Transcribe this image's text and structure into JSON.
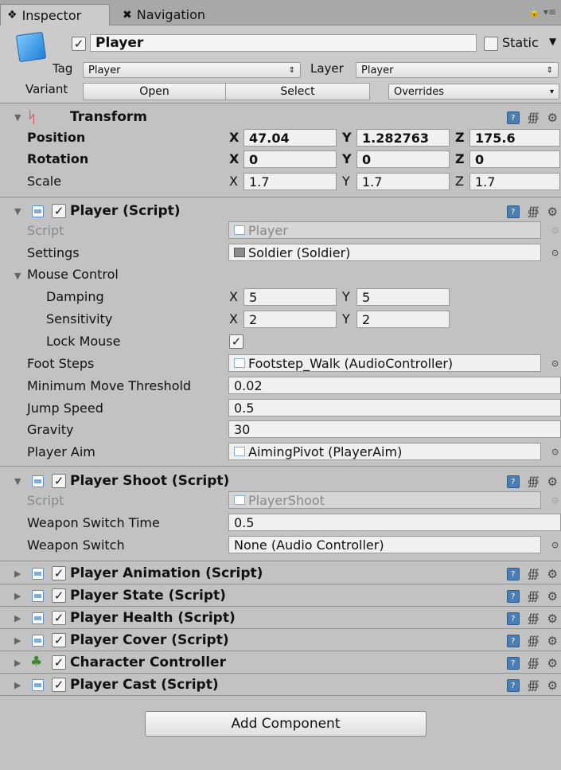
{
  "tabs": {
    "inspector": "Inspector",
    "navigation": "Navigation"
  },
  "gameobject": {
    "name": "Player",
    "active": true,
    "static_label": "Static",
    "tag_label": "Tag",
    "tag_value": "Player",
    "layer_label": "Layer",
    "layer_value": "Player",
    "variant_label": "Variant",
    "open_label": "Open",
    "select_label": "Select",
    "overrides_label": "Overrides"
  },
  "transform": {
    "title": "Transform",
    "position": {
      "label": "Position",
      "x": "47.04",
      "y": "1.282763",
      "z": "175.6"
    },
    "rotation": {
      "label": "Rotation",
      "x": "0",
      "y": "0",
      "z": "0"
    },
    "scale": {
      "label": "Scale",
      "x": "1.7",
      "y": "1.7",
      "z": "1.7"
    },
    "axis": {
      "x": "X",
      "y": "Y",
      "z": "Z"
    }
  },
  "player_script": {
    "title": "Player (Script)",
    "script_label": "Script",
    "script_value": "Player",
    "settings_label": "Settings",
    "settings_value": "Soldier (Soldier)",
    "mouse_control_label": "Mouse Control",
    "damping_label": "Damping",
    "damping_x": "5",
    "damping_y": "5",
    "sensitivity_label": "Sensitivity",
    "sensitivity_x": "2",
    "sensitivity_y": "2",
    "lock_mouse_label": "Lock Mouse",
    "foot_steps_label": "Foot Steps",
    "foot_steps_value": "Footstep_Walk (AudioController)",
    "min_move_label": "Minimum Move Threshold",
    "min_move_value": "0.02",
    "jump_speed_label": "Jump Speed",
    "jump_speed_value": "0.5",
    "gravity_label": "Gravity",
    "gravity_value": "30",
    "player_aim_label": "Player Aim",
    "player_aim_value": "AimingPivot (PlayerAim)"
  },
  "player_shoot": {
    "title": "Player Shoot (Script)",
    "script_label": "Script",
    "script_value": "PlayerShoot",
    "weapon_switch_time_label": "Weapon Switch Time",
    "weapon_switch_time_value": "0.5",
    "weapon_switch_label": "Weapon Switch",
    "weapon_switch_value": "None (Audio Controller)"
  },
  "collapsed_components": [
    "Player Animation (Script)",
    "Player State (Script)",
    "Player Health (Script)",
    "Player Cover (Script)",
    "Character Controller",
    "Player Cast (Script)"
  ],
  "add_component_label": "Add Component"
}
